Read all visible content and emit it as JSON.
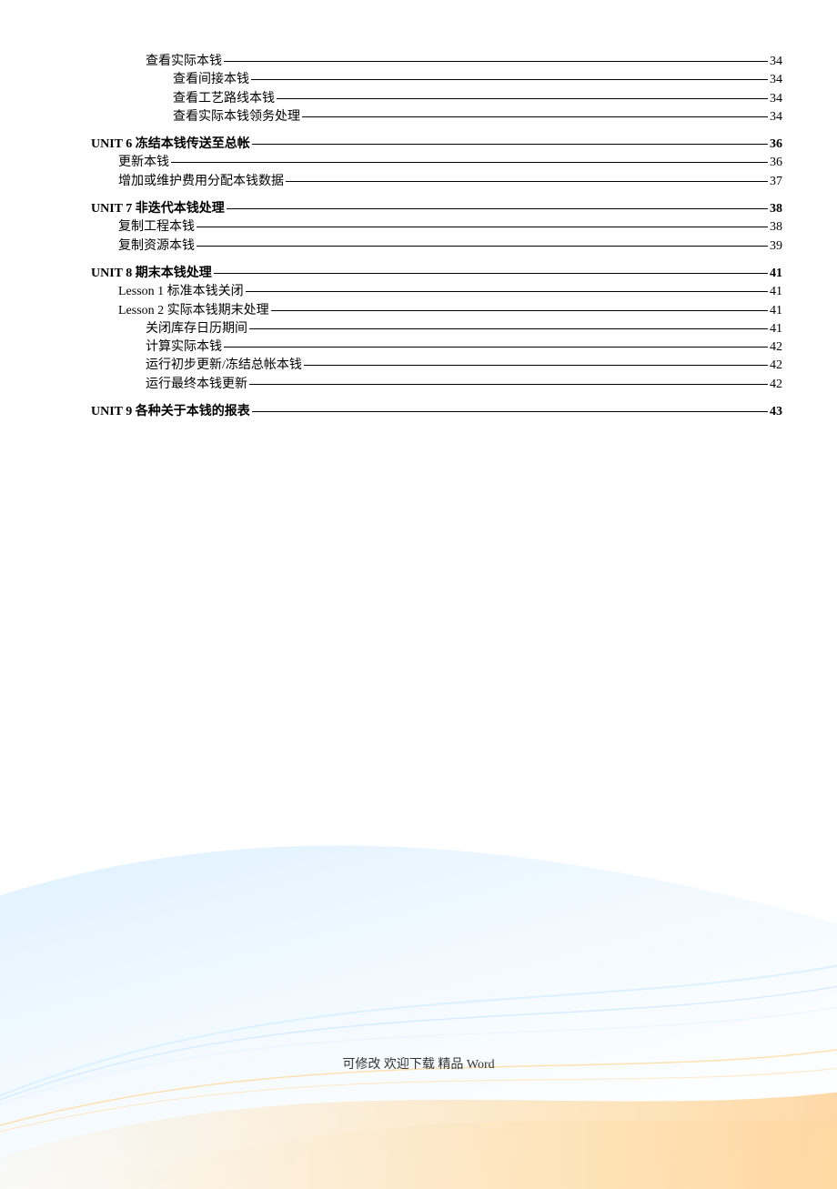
{
  "toc": [
    {
      "level": 2,
      "label": "查看实际本钱",
      "page": "34"
    },
    {
      "level": 3,
      "label": "查看间接本钱",
      "page": "34"
    },
    {
      "level": 3,
      "label": "查看工艺路线本钱",
      "page": "34"
    },
    {
      "level": 3,
      "label": "查看实际本钱领务处理",
      "page": "34"
    },
    {
      "level": 0,
      "label": "UNIT 6 冻结本钱传送至总帐",
      "page": "36"
    },
    {
      "level": 1,
      "label": "更新本钱",
      "page": "36"
    },
    {
      "level": 1,
      "label": "增加或维护费用分配本钱数据",
      "page": "37"
    },
    {
      "level": 0,
      "label": "UNIT 7 非迭代本钱处理",
      "page": "38"
    },
    {
      "level": 1,
      "label": "复制工程本钱",
      "page": "38"
    },
    {
      "level": 1,
      "label": "复制资源本钱",
      "page": "39"
    },
    {
      "level": 0,
      "label": "UNIT 8 期末本钱处理",
      "page": "41"
    },
    {
      "level": 1,
      "label": "Lesson 1 标准本钱关闭",
      "page": "41"
    },
    {
      "level": 1,
      "label": "Lesson 2  实际本钱期末处理",
      "page": "41"
    },
    {
      "level": 2,
      "label": "关闭库存日历期间",
      "page": "41"
    },
    {
      "level": 2,
      "label": "计算实际本钱",
      "page": "42"
    },
    {
      "level": 2,
      "label": "运行初步更新/冻结总帐本钱",
      "page": "42"
    },
    {
      "level": 2,
      "label": "运行最终本钱更新",
      "page": "42"
    },
    {
      "level": 0,
      "label": "UNIT 9 各种关于本钱的报表",
      "page": "43"
    }
  ],
  "footer": "可修改 欢迎下载 精品  Word"
}
